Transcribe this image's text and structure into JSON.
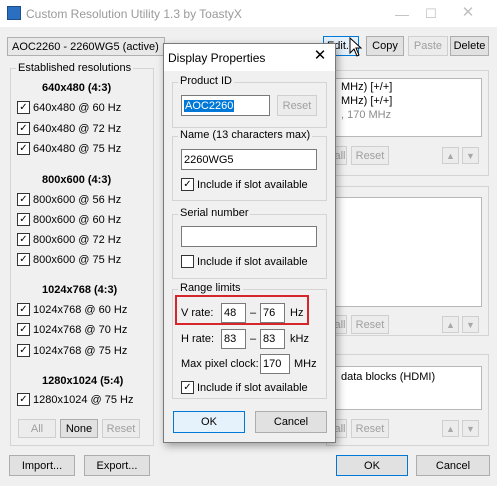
{
  "app": {
    "title": "Custom Resolution Utility 1.3 by ToastyX"
  },
  "monitor_combo": {
    "value": "AOC2260 - 2260WG5 (active)"
  },
  "top_buttons": {
    "edit": "Edit...",
    "copy": "Copy",
    "paste": "Paste",
    "delete": "Delete"
  },
  "established": {
    "title": "Established resolutions",
    "groups": [
      {
        "header": "640x480 (4:3)",
        "items": [
          "640x480 @ 60 Hz",
          "640x480 @ 72 Hz",
          "640x480 @ 75 Hz"
        ]
      },
      {
        "header": "800x600 (4:3)",
        "items": [
          "800x600 @ 56 Hz",
          "800x600 @ 60 Hz",
          "800x600 @ 72 Hz",
          "800x600 @ 75 Hz"
        ]
      },
      {
        "header": "1024x768 (4:3)",
        "items": [
          "1024x768 @ 60 Hz",
          "1024x768 @ 70 Hz",
          "1024x768 @ 75 Hz"
        ]
      },
      {
        "header": "1280x1024 (5:4)",
        "items": [
          "1280x1024 @ 75 Hz"
        ]
      }
    ],
    "buttons": {
      "all": "All",
      "none": "None",
      "reset": "Reset"
    }
  },
  "right_panel": {
    "list1_lines": [
      "MHz) [+/+]",
      "MHz) [+/+]",
      ", 170 MHz"
    ],
    "list3_lines": [
      "data blocks (HDMI)"
    ],
    "partial_all_label": "all",
    "reset_label": "Reset",
    "up_icon": "arrow-up-icon",
    "down_icon": "arrow-down-icon"
  },
  "bottom": {
    "import": "Import...",
    "export": "Export...",
    "ok": "OK",
    "cancel": "Cancel"
  },
  "dialog": {
    "title": "Display Properties",
    "product_id": {
      "title": "Product ID",
      "value": "AOC2260",
      "reset": "Reset"
    },
    "name": {
      "title": "Name (13 characters max)",
      "value": "2260WG5",
      "include_label": "Include if slot available",
      "include_checked": true
    },
    "serial": {
      "title": "Serial number",
      "value": "",
      "include_label": "Include if slot available",
      "include_checked": false
    },
    "range": {
      "title": "Range limits",
      "vrate_label": "V rate:",
      "vrate_min": "48",
      "vrate_dash": "–",
      "vrate_max": "76",
      "vrate_unit": "Hz",
      "hrate_label": "H rate:",
      "hrate_min": "83",
      "hrate_dash": "–",
      "hrate_max": "83",
      "hrate_unit": "kHz",
      "maxclk_label": "Max pixel clock:",
      "maxclk_value": "170",
      "maxclk_unit": "MHz",
      "include_label": "Include if slot available",
      "include_checked": true
    },
    "ok": "OK",
    "cancel": "Cancel"
  },
  "colors": {
    "highlight": "#d6262b",
    "selection": "#0078d7"
  }
}
